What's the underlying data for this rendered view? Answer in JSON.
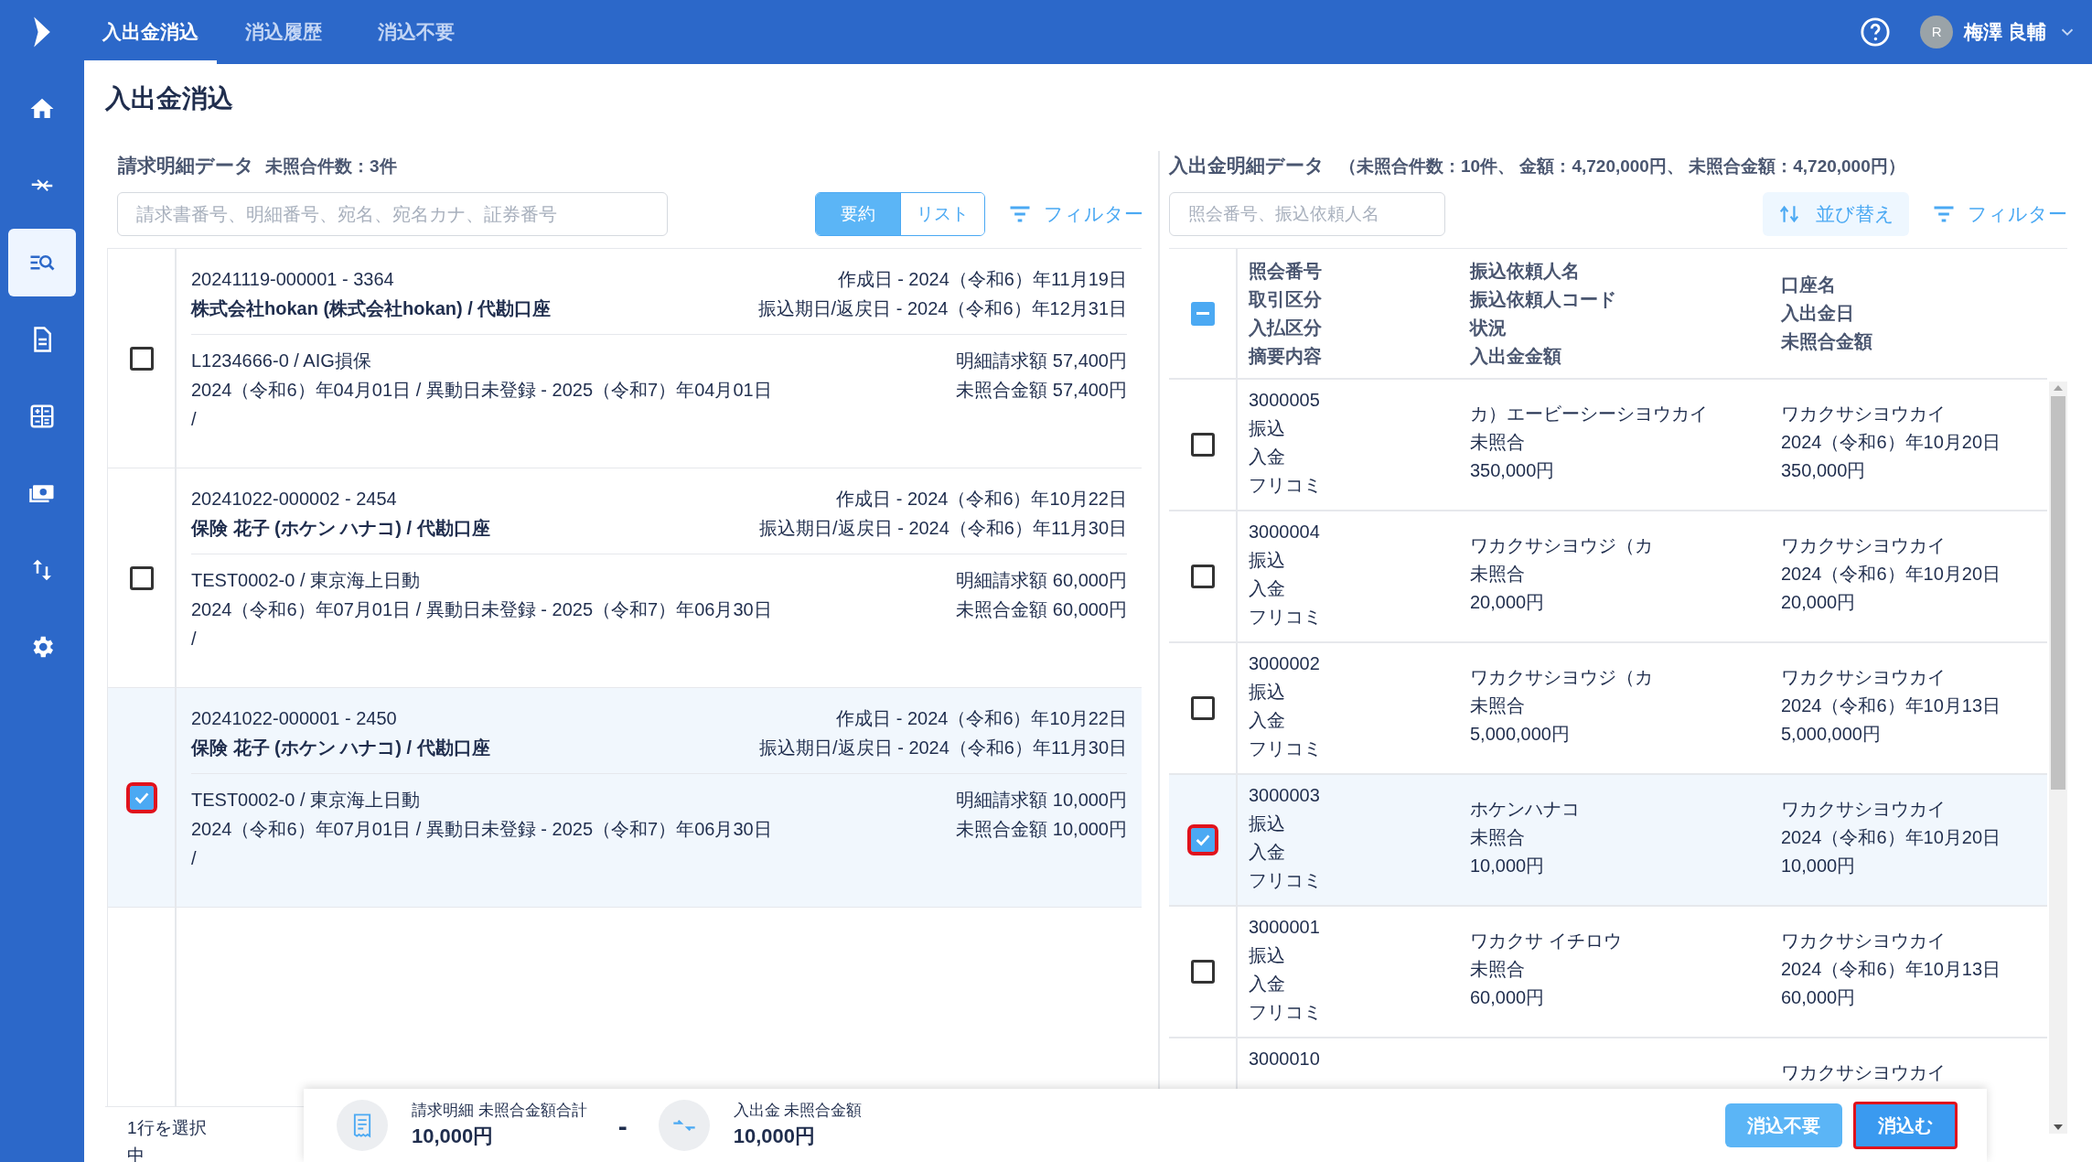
{
  "nav_tabs": [
    {
      "label": "入出金消込",
      "selected": true
    },
    {
      "label": "消込履歴",
      "selected": false
    },
    {
      "label": "消込不要",
      "selected": false
    }
  ],
  "user": {
    "avatar_initial": "R",
    "name": "梅澤 良輔"
  },
  "sidebar": {
    "items": [
      {
        "kind": "home",
        "selected": false
      },
      {
        "kind": "arrows",
        "selected": false
      },
      {
        "kind": "search-list",
        "selected": true
      },
      {
        "kind": "document",
        "selected": false
      },
      {
        "kind": "calculator",
        "selected": false
      },
      {
        "kind": "cash",
        "selected": false
      },
      {
        "kind": "swap",
        "selected": false
      },
      {
        "kind": "gear",
        "selected": false
      }
    ]
  },
  "page_title": "入出金消込",
  "invoices": {
    "title": "請求明細データ",
    "summary": "未照合件数：3件",
    "search": {
      "placeholder": "請求書番号、明細番号、宛名、宛名カナ、証券番号"
    },
    "view_toggle": [
      {
        "label": "要約",
        "selected": true
      },
      {
        "label": "リスト",
        "selected": false
      }
    ],
    "filter_button": "フィルター",
    "items": [
      {
        "checked": false,
        "number": "20241119-000001 - 3364",
        "party": "株式会社hokan (株式会社hokan) / 代勘口座",
        "created": "作成日 - 2024（令和6）年11月19日",
        "due": "振込期日/返戻日 - 2024（令和6）年12月31日",
        "policy": "L1234666-0 / AIG損保",
        "period": "2024（令和6）年04月01日 / 異動日未登録 - 2025（令和7）年04月01日",
        "note": "/",
        "billed": "明細請求額 57,400円",
        "unmatched": "未照合金額 57,400円"
      },
      {
        "checked": false,
        "number": "20241022-000002 - 2454",
        "party": "保険 花子 (ホケン ハナコ) / 代勘口座",
        "created": "作成日 - 2024（令和6）年10月22日",
        "due": "振込期日/返戻日 - 2024（令和6）年11月30日",
        "policy": "TEST0002-0 / 東京海上日動",
        "period": "2024（令和6）年07月01日 / 異動日未登録 - 2025（令和7）年06月30日",
        "note": "/",
        "billed": "明細請求額 60,000円",
        "unmatched": "未照合金額 60,000円"
      },
      {
        "checked": true,
        "number": "20241022-000001 - 2450",
        "party": "保険 花子 (ホケン ハナコ) / 代勘口座",
        "created": "作成日 - 2024（令和6）年10月22日",
        "due": "振込期日/返戻日 - 2024（令和6）年11月30日",
        "policy": "TEST0002-0 / 東京海上日動",
        "period": "2024（令和6）年07月01日 / 異動日未登録 - 2025（令和7）年06月30日",
        "note": "/",
        "billed": "明細請求額 10,000円",
        "unmatched": "未照合金額 10,000円"
      }
    ],
    "selection_status": "1行を選択中"
  },
  "payments": {
    "title": "入出金明細データ",
    "summary": "（未照合件数：10件、 金額：4,720,000円、 未照合金額：4,720,000円）",
    "search": {
      "placeholder": "照会番号、振込依頼人名"
    },
    "sort_button": "並び替え",
    "filter_button": "フィルター",
    "select_all": {
      "indeterminate": true
    },
    "columns": [
      [
        "照会番号",
        "取引区分",
        "入払区分",
        "摘要内容"
      ],
      [
        "振込依頼人名",
        "振込依頼人コード",
        "状況",
        "入出金金額"
      ],
      [
        "口座名",
        "入出金日",
        "未照合金額"
      ]
    ],
    "rows": [
      {
        "checked": false,
        "col1": [
          "3000005",
          "振込",
          "入金",
          "フリコミ"
        ],
        "col2": [
          "カ）エービーシーシヨウカイ",
          "未照合",
          "350,000円"
        ],
        "col3": [
          "ワカクサシヨウカイ",
          "2024（令和6）年10月20日",
          "350,000円"
        ]
      },
      {
        "checked": false,
        "col1": [
          "3000004",
          "振込",
          "入金",
          "フリコミ"
        ],
        "col2": [
          "ワカクサシヨウジ（カ",
          "未照合",
          "20,000円"
        ],
        "col3": [
          "ワカクサシヨウカイ",
          "2024（令和6）年10月20日",
          "20,000円"
        ]
      },
      {
        "checked": false,
        "col1": [
          "3000002",
          "振込",
          "入金",
          "フリコミ"
        ],
        "col2": [
          "ワカクサシヨウジ（カ",
          "未照合",
          "5,000,000円"
        ],
        "col3": [
          "ワカクサシヨウカイ",
          "2024（令和6）年10月13日",
          "5,000,000円"
        ]
      },
      {
        "checked": true,
        "col1": [
          "3000003",
          "振込",
          "入金",
          "フリコミ"
        ],
        "col2": [
          "ホケンハナコ",
          "未照合",
          "10,000円"
        ],
        "col3": [
          "ワカクサシヨウカイ",
          "2024（令和6）年10月20日",
          "10,000円"
        ]
      },
      {
        "checked": false,
        "col1": [
          "3000001",
          "振込",
          "入金",
          "フリコミ"
        ],
        "col2": [
          "ワカクサ イチロウ",
          "未照合",
          "60,000円"
        ],
        "col3": [
          "ワカクサシヨウカイ",
          "2024（令和6）年10月13日",
          "60,000円"
        ]
      },
      {
        "col1": [
          "3000010"
        ],
        "col3": [
          "ワカクサシヨウカイ"
        ]
      }
    ]
  },
  "action_bar": {
    "invoice_total": {
      "label": "請求明細 未照合金額合計",
      "value": "10,000円"
    },
    "operator": "-",
    "payment_total": {
      "label": "入出金 未照合金額",
      "value": "10,000円"
    },
    "buttons": [
      {
        "label": "消込不要",
        "kind": "secondary"
      },
      {
        "label": "消込む",
        "kind": "primary"
      }
    ]
  }
}
